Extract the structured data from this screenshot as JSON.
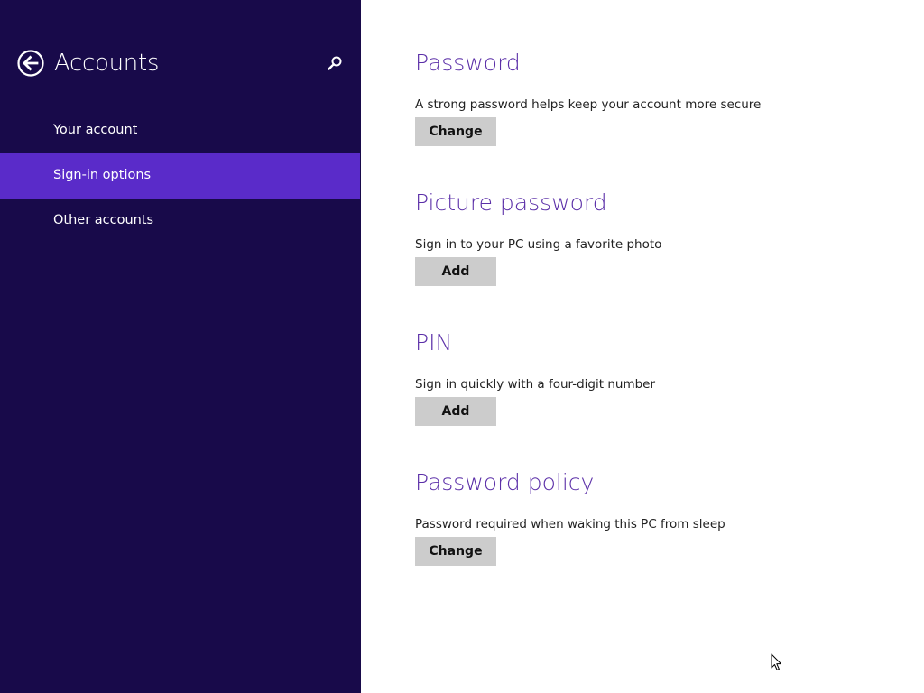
{
  "theme": {
    "sidebar_bg": "#180a4a",
    "selected_bg": "#5a2bc9",
    "heading_color": "#5b2fa8",
    "button_bg": "#cccccc"
  },
  "sidebar": {
    "title": "Accounts",
    "back_icon": "back-arrow-circle-icon",
    "search_icon": "search-icon",
    "items": [
      {
        "label": "Your account",
        "selected": false
      },
      {
        "label": "Sign-in options",
        "selected": true
      },
      {
        "label": "Other accounts",
        "selected": false
      }
    ]
  },
  "main": {
    "sections": [
      {
        "title": "Password",
        "description": "A strong password helps keep your account more secure",
        "button_label": "Change"
      },
      {
        "title": "Picture password",
        "description": "Sign in to your PC using a favorite photo",
        "button_label": "Add"
      },
      {
        "title": "PIN",
        "description": "Sign in quickly with a four-digit number",
        "button_label": "Add"
      },
      {
        "title": "Password policy",
        "description": "Password required when waking this PC from sleep",
        "button_label": "Change"
      }
    ]
  }
}
